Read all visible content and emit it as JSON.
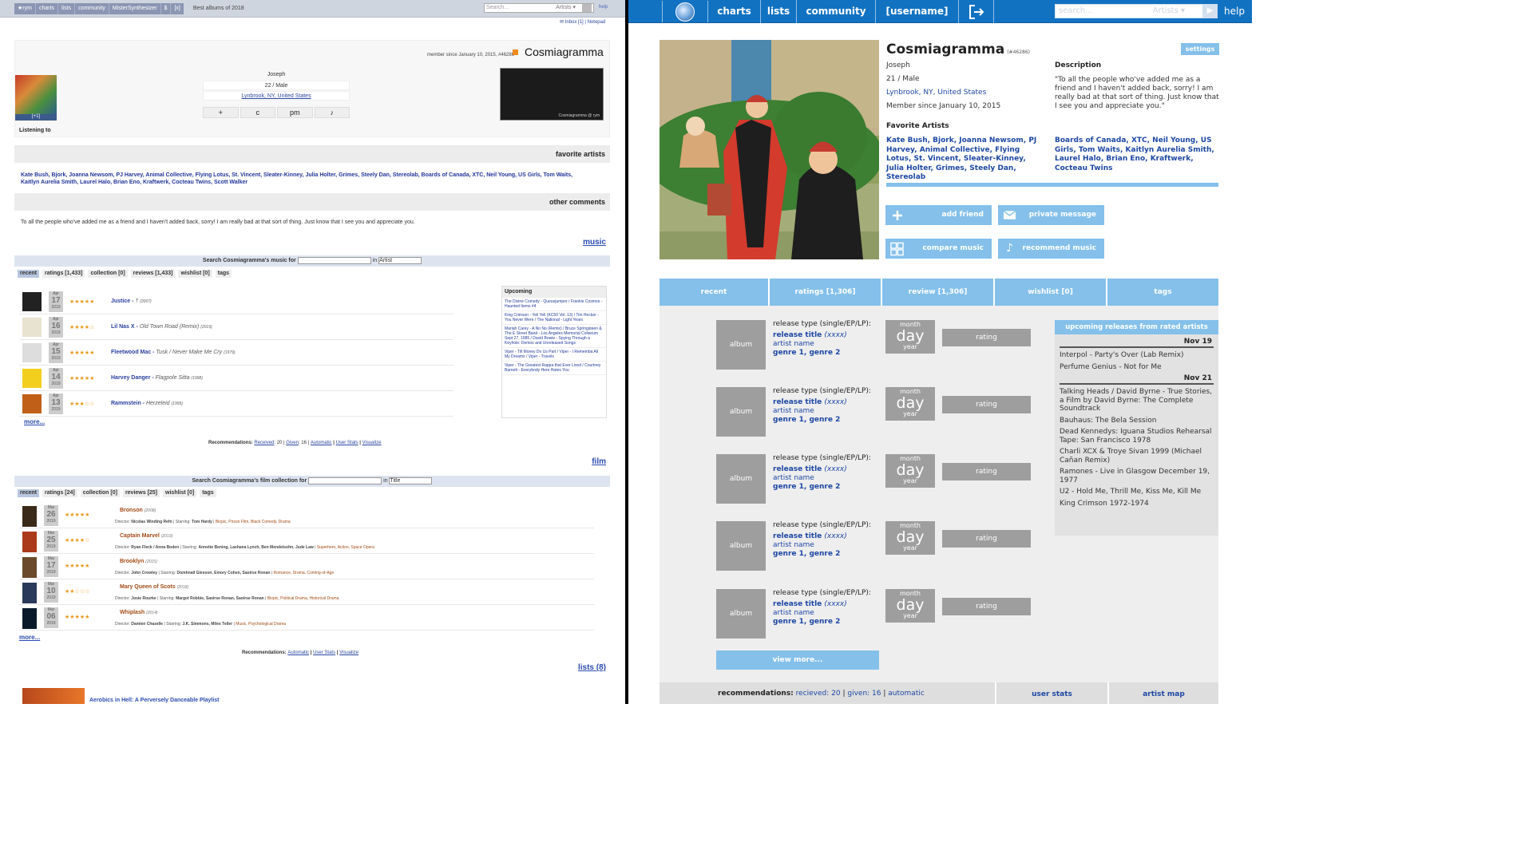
{
  "left": {
    "nav": [
      "★rym",
      "charts",
      "lists",
      "community",
      "MisterSynthesizer",
      "$",
      "[x]"
    ],
    "page_title": "Best albums of 2018",
    "search_placeholder": "Search...",
    "search_scope": "Artists ▾",
    "help": "help",
    "inbox": "✉ Inbox [1] | Notepad",
    "member_since": "member since January 10, 2015, #46286",
    "username": "Cosmiagramma",
    "art_caption": "[+1]",
    "info": {
      "name": "Joseph",
      "age_gender": "22 / Male",
      "location": "Lynbrook, NY, United States"
    },
    "buttons": [
      "+",
      "c",
      "pm",
      "♪"
    ],
    "map_label": "Cosmiagramma @ rym",
    "listening_to": "Listening to",
    "favorite_artists_title": "favorite artists",
    "favorite_artists": "Kate Bush, Bjork, Joanna Newsom, PJ Harvey, Animal Collective, Flying Lotus, St. Vincent, Sleater-Kinney, Julia Holter, Grimes, Steely Dan, Stereolab, Boards of Canada, XTC, Neil Young, US Girls, Tom Waits, Kaitlyn Aurelia Smith, Laurel Halo, Brian Eno, Kraftwerk, Cocteau Twins, Scott Walker",
    "other_comments_title": "other comments",
    "comment": "To all the people who've added me as a friend and I haven't added back, sorry! I am really bad at that sort of thing. Just know that I see you and appreciate you.",
    "music_link": "music",
    "music_search": "Search Cosmiagramma's music for",
    "music_search_in": "in",
    "music_search_scope": "Artist",
    "music_tabs": [
      "recent",
      "ratings [1,433]",
      "collection [0]",
      "reviews [1,433]",
      "wishlist [0]",
      "tags"
    ],
    "music_rows": [
      {
        "mon": "Apr",
        "day": "17",
        "year": "2019",
        "stars": "★★★★★",
        "artist": "Justice",
        "title": "†",
        "year_rel": "(2007)"
      },
      {
        "mon": "Apr",
        "day": "16",
        "year": "2019",
        "stars": "★★★★☆",
        "artist": "Lil Nas X",
        "title": "Old Town Road (Remix)",
        "year_rel": "(2019)"
      },
      {
        "mon": "Apr",
        "day": "15",
        "year": "2019",
        "stars": "★★★★★",
        "artist": "Fleetwood Mac",
        "title": "Tusk / Never Make Me Cry",
        "year_rel": "(1979)"
      },
      {
        "mon": "Apr",
        "day": "14",
        "year": "2019",
        "stars": "★★★★★",
        "artist": "Harvey Danger",
        "title": "Flagpole Sitta",
        "year_rel": "(1998)"
      },
      {
        "mon": "Apr",
        "day": "13",
        "year": "2019",
        "stars": "★★★☆☆",
        "artist": "Rammstein",
        "title": "Herzeleid",
        "year_rel": "(1995)"
      }
    ],
    "more": "more...",
    "upcoming_title": "Upcoming",
    "upcoming": [
      "The Divine Comedy - Queuejumper / Frankie Cosmos - Haunted Items #4",
      "King Crimson - Yeli Yeli (KC50 Vol. 13) / Tim Hecker - You Never Were / The National - Light Years",
      "Mariah Carey - A No No (Remix) / Bruce Springsteen & The E Street Band - Los Angeles Memorial Coliseum Sept 27, 1985 / David Bowie - Spying Through a Keyhole: Demos and Unreleased Songs",
      "Viper - Till Money Do Us Part / Viper - I Rememba All My Dreams / Viper - Travels",
      "Viper - The Greatest Rappa that Ever Lived / Courtney Barnett - Everybody Here Hates You"
    ],
    "recs_music": {
      "label": "Recommendations:",
      "received": "Received",
      "received_n": ": 20 |",
      "given": "Given",
      "given_n": ": 16 |",
      "automatic": "Automatic",
      "user_stats": "User Stats",
      "visualize": "Visualize"
    },
    "film_link": "film",
    "film_search": "Search Cosmiagramma's film collection for",
    "film_search_scope": "Title",
    "film_tabs": [
      "recent",
      "ratings [24]",
      "collection [0]",
      "reviews [25]",
      "wishlist [0]",
      "tags"
    ],
    "film_rows": [
      {
        "mon": "Mar",
        "day": "26",
        "year": "2019",
        "stars": "★★★★★",
        "title": "Bronson",
        "yr": "(2008)",
        "director": "Nicolas Winding Refn",
        "starring": "Tom Hardy",
        "genres": "Biopic, Prison Film, Black Comedy, Drama"
      },
      {
        "mon": "Mar",
        "day": "25",
        "year": "2019",
        "stars": "★★★★☆",
        "title": "Captain Marvel",
        "yr": "(2019)",
        "director": "Ryan Fleck / Anna Boden",
        "starring": "Annette Bening, Lashana Lynch, Ben Mendelsohn, Jude Law",
        "genres": "Superhero, Action, Space Opera"
      },
      {
        "mon": "Mar",
        "day": "17",
        "year": "2019",
        "stars": "★★★★★",
        "title": "Brooklyn",
        "yr": "(2015)",
        "director": "John Crowley",
        "starring": "Domhnall Gleeson, Emory Cohen, Saoirse Ronan",
        "genres": "Romance, Drama, Coming-of-Age"
      },
      {
        "mon": "Mar",
        "day": "10",
        "year": "2019",
        "stars": "★★☆☆☆",
        "title": "Mary Queen of Scots",
        "yr": "(2018)",
        "director": "Josie Rourke",
        "starring": "Margot Robbie, Saoirse Ronan, Saoirse Ronan",
        "genres": "Biopic, Political Drama, Historical Drama"
      },
      {
        "mon": "Mar",
        "day": "06",
        "year": "2019",
        "stars": "★★★★★",
        "title": "Whiplash",
        "yr": "(2014)",
        "director": "Damien Chazelle",
        "starring": "J.K. Simmons, Miles Teller",
        "genres": "Music, Psychological Drama"
      }
    ],
    "director_label": "Director:",
    "starring_label": "Starring:",
    "recs_film": {
      "label": "Recommendations:",
      "automatic": "Automatic",
      "user_stats": "User Stats",
      "visualize": "Visualize"
    },
    "lists_link": "lists (8)",
    "playlist_title": "Aerobics in Hell: A Perversely Danceable Playlist"
  },
  "right": {
    "nav": {
      "charts": "charts",
      "lists": "lists",
      "community": "community",
      "username": "[username]",
      "search_placeholder": "search...",
      "search_scope": "Artists ▾",
      "help": "help"
    },
    "name": "Cosmiagramma",
    "user_id": "(#46286)",
    "settings": "settings",
    "real_name": "Joseph",
    "age_gender": "21 / Male",
    "location": "Lynbrook, NY, United States",
    "member_since": "Member since January 10, 2015",
    "description_title": "Description",
    "description": "\"To all the people who've added me as a friend and I haven't added back, sorry! I am really bad at that sort of thing. Just know that I see you and appreciate you.\"",
    "favorite_artists_title": "Favorite Artists",
    "favorite_artists_1": "Kate Bush, Bjork, Joanna Newsom, PJ Harvey, Animal Collective, Flying Lotus, St. Vincent, Sleater-Kinney, Julia Holter, Grimes, Steely Dan, Stereolab",
    "favorite_artists_2": "Boards of Canada, XTC, Neil Young, US Girls, Tom Waits, Kaitlyn Aurelia Smith, Laurel Halo, Brian Eno, Kraftwerk, Cocteau Twins",
    "actions": {
      "add_friend": "add friend",
      "private_message": "private message",
      "compare_music": "compare music",
      "recommend_music": "recommend music"
    },
    "tabs": [
      "recent",
      "ratings [1,306]",
      "review [1,306]",
      "wishlist [0]",
      "tags"
    ],
    "release_template": {
      "album": "album",
      "type": "release type (single/EP/LP):",
      "title": "release title",
      "year": "(xxxx)",
      "artist": "artist name",
      "genres": "genre 1, genre 2",
      "month": "month",
      "day": "day",
      "yr": "year",
      "rating": "rating"
    },
    "view_more": "view more...",
    "upcoming_title": "upcoming releases from rated artists",
    "upcoming_groups": [
      {
        "date": "Nov 19",
        "items": [
          "Interpol - Party's Over (Lab Remix)",
          "Perfume Genius - Not for Me"
        ]
      },
      {
        "date": "Nov 21",
        "items": [
          "Talking Heads / David Byrne - True Stories, a Film by David Byrne: The Complete Soundtrack",
          "Bauhaus: The Bela Session",
          "Dead Kennedys: Iguana Studios Rehearsal Tape: San Francisco 1978",
          "Charli XCX & Troye Sivan 1999 (Michael Cañan Remix)",
          "Ramones - Live in Glasgow December 19, 1977",
          "U2 - Hold Me, Thrill Me, Kiss Me, Kill Me",
          "King Crimson 1972-1974"
        ]
      }
    ],
    "recs": {
      "label": "recommendations:",
      "received": "recieved: 20",
      "given": "given: 16",
      "automatic": "automatic"
    },
    "user_stats": "user stats",
    "artist_map": "artist map"
  }
}
